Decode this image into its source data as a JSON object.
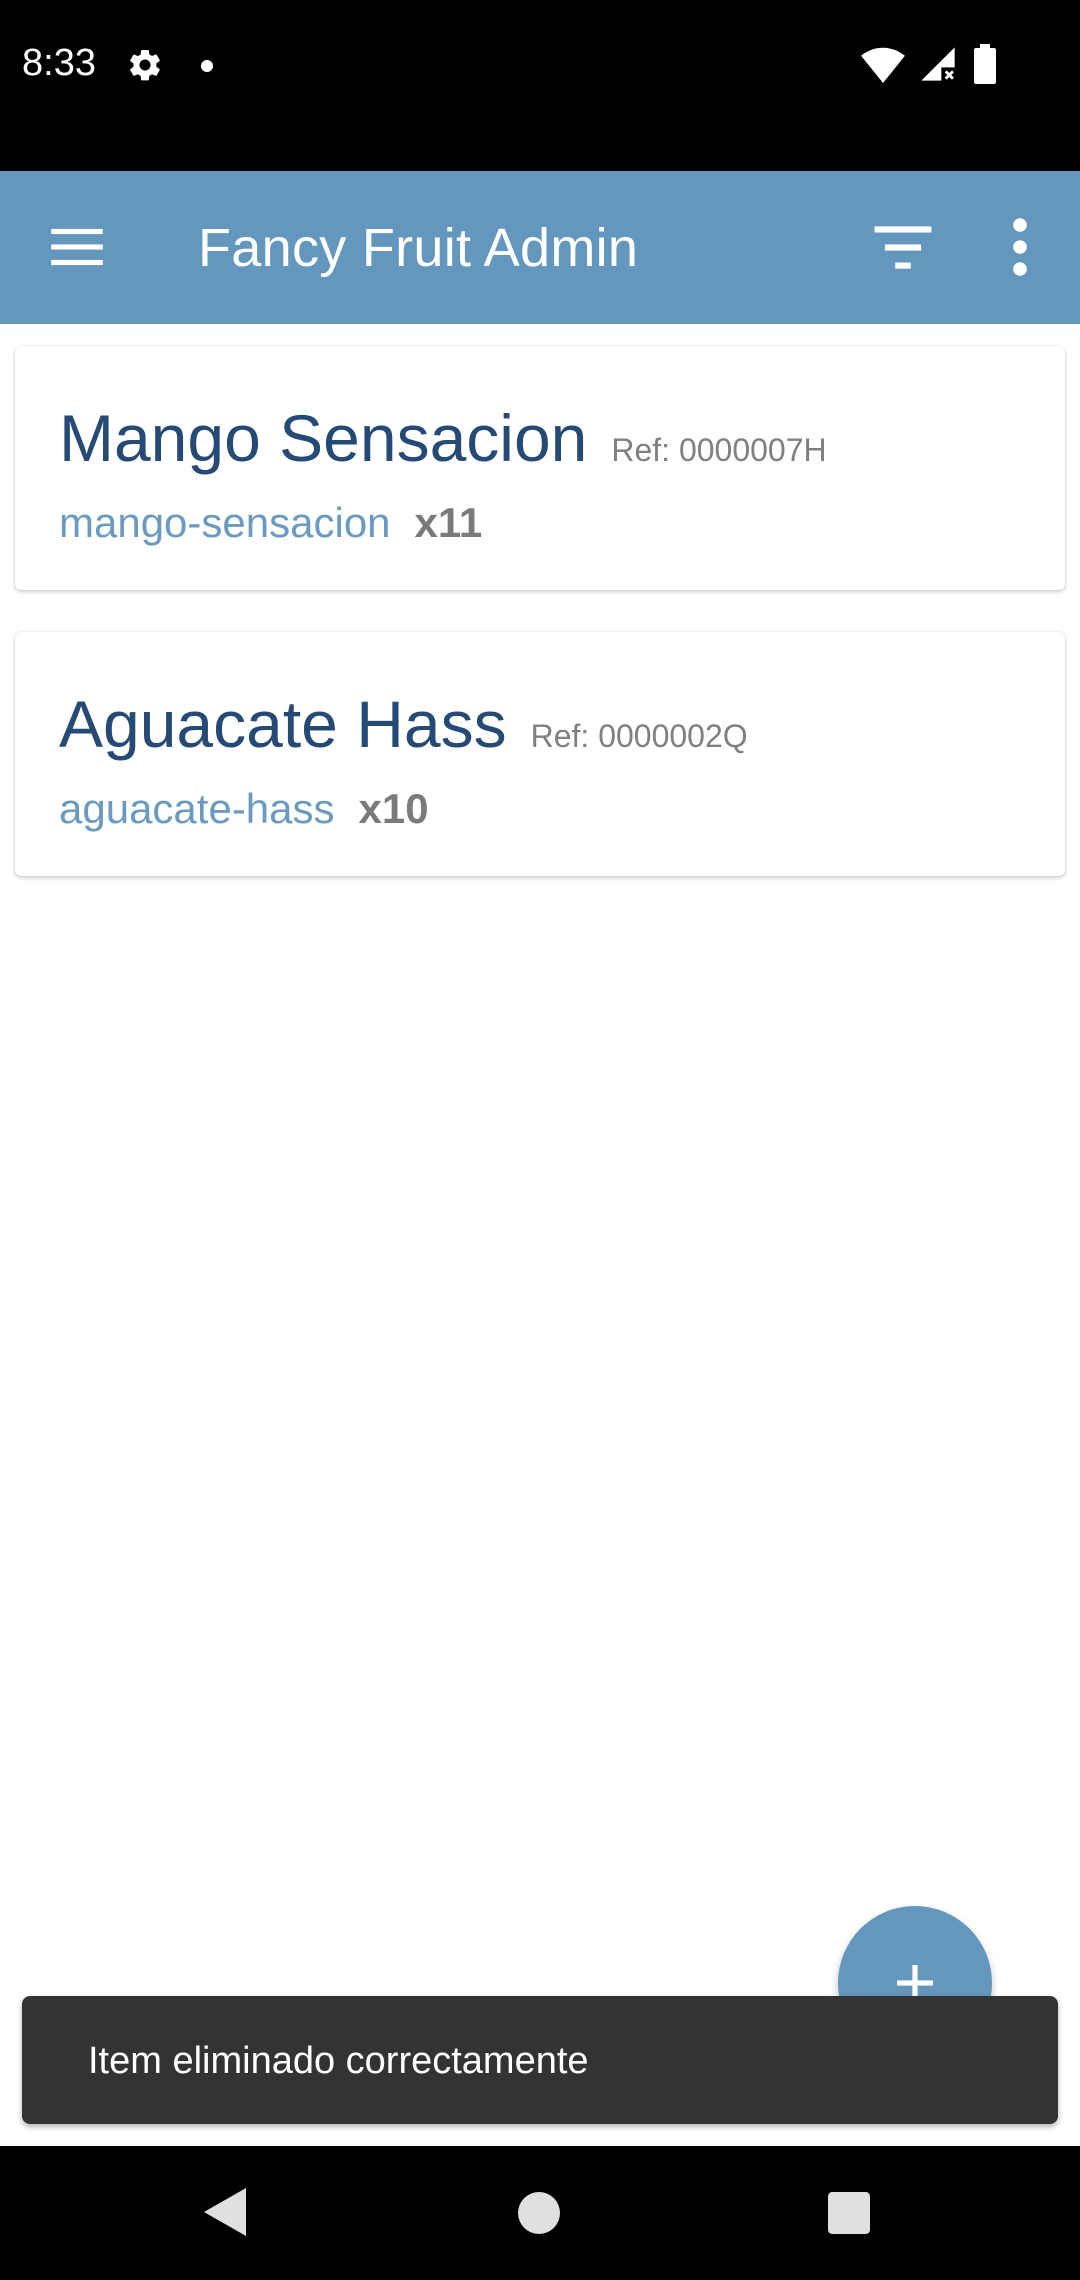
{
  "status_bar": {
    "time": "8:33",
    "icons": [
      "gear-icon",
      "notification-dot-icon",
      "wifi-icon",
      "cellular-signal-icon",
      "battery-icon"
    ]
  },
  "app_bar": {
    "title": "Fancy Fruit Admin",
    "icons": [
      "menu-icon",
      "filter-icon",
      "more-vert-icon"
    ]
  },
  "items": [
    {
      "name": "Mango Sensacion",
      "ref": "Ref: 0000007H",
      "slug": "mango-sensacion",
      "qty": "x11"
    },
    {
      "name": "Aguacate Hass",
      "ref": "Ref: 0000002Q",
      "slug": "aguacate-hass",
      "qty": "x10"
    }
  ],
  "fab": {
    "icon": "add-icon"
  },
  "snackbar": {
    "message": "Item eliminado correctamente"
  },
  "nav_bar": {
    "icons": [
      "back-icon",
      "home-icon",
      "recents-icon"
    ]
  },
  "colors": {
    "primary": "#6497bd",
    "item_title": "#254a75",
    "slug": "#6a9ac0",
    "snackbar": "#333333"
  }
}
